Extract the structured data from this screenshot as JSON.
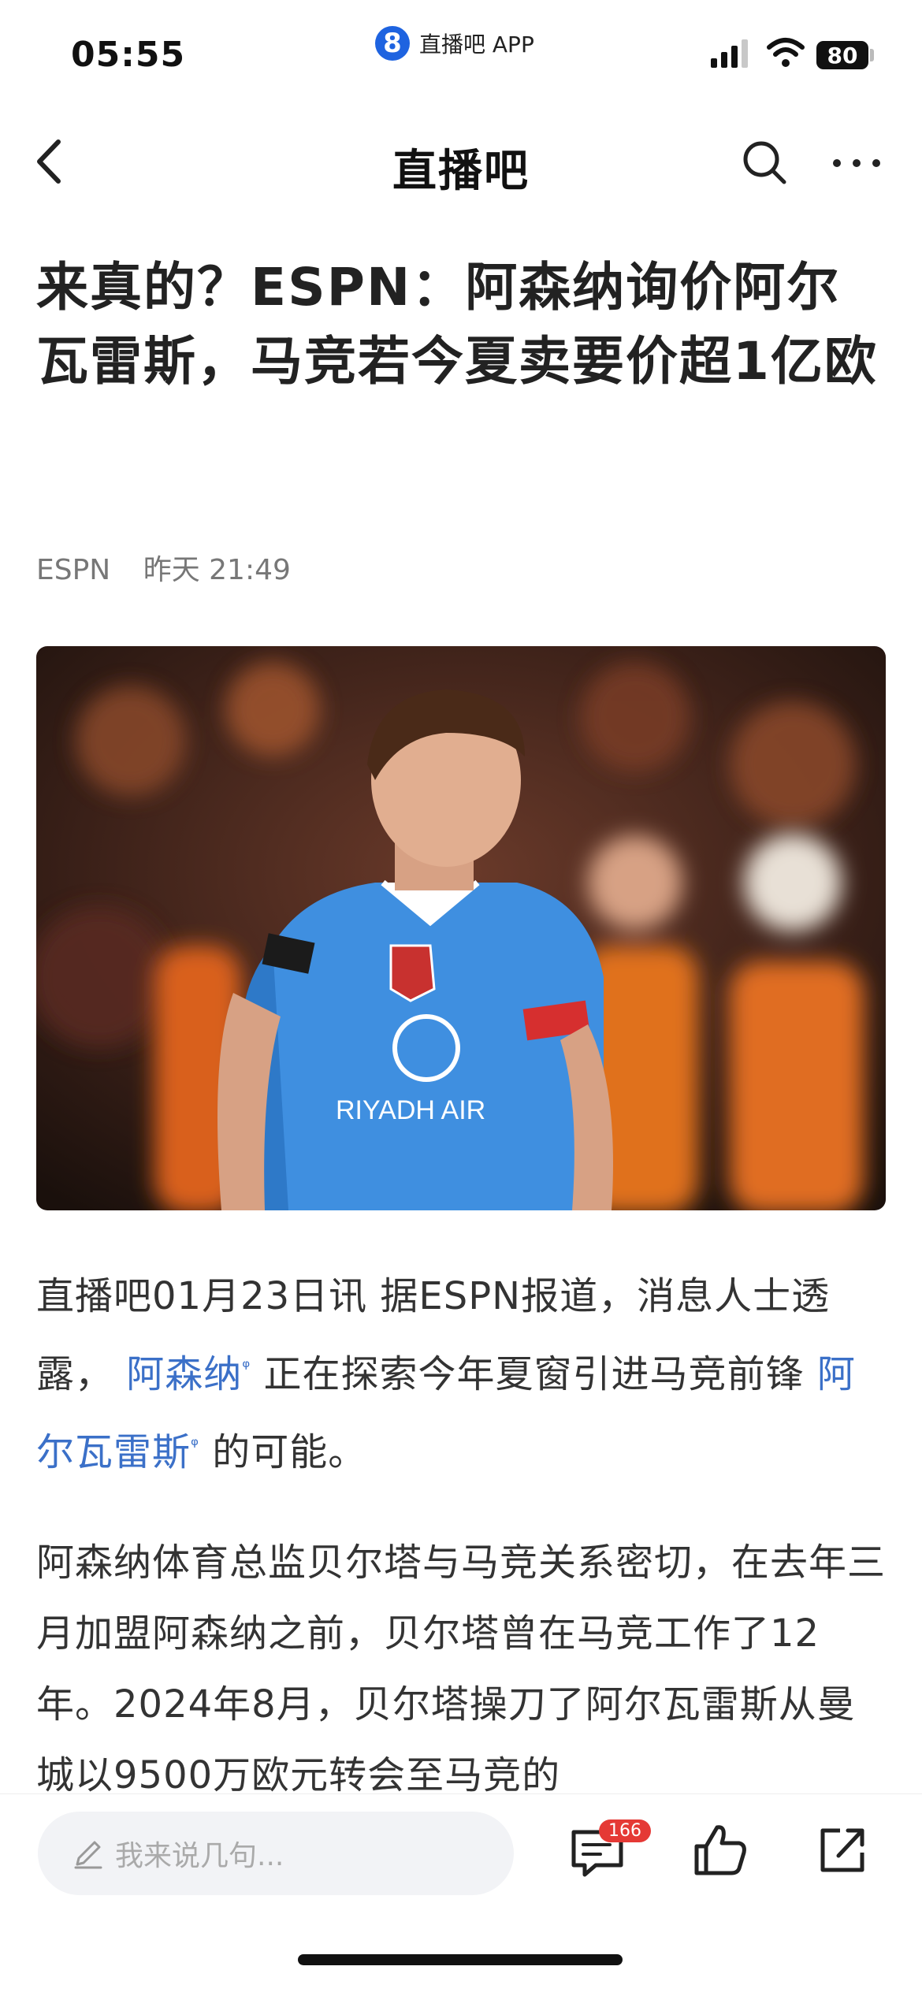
{
  "status_bar": {
    "time": "05:55",
    "app_logo": "8",
    "app_name": "直播吧 APP",
    "battery": "80"
  },
  "nav": {
    "title": "直播吧",
    "icons": [
      "back-arrow-icon",
      "search-icon",
      "more-icon"
    ]
  },
  "article": {
    "title": "来真的？ESPN：阿森纳询价阿尔瓦雷斯，马竞若今夏卖要价超1亿欧",
    "source": "ESPN",
    "time": "昨天 21:49",
    "hero_image": {
      "jersey_text": "RIYADH AIR"
    },
    "paragraph1": {
      "part1": "直播吧01月23日讯 据ESPN报道，消息人士透露，",
      "link1": "阿森纳",
      "part2": " 正在探索今年夏窗引进马竞前锋",
      "link2": "阿尔瓦雷斯",
      "part3": " 的可能。"
    },
    "paragraph2": "阿森纳体育总监贝尔塔与马竞关系密切，在去年三月加盟阿森纳之前，贝尔塔曾在马竞工作了12年。2024年8月，贝尔塔操刀了阿尔瓦雷斯从曼城以9500万欧元转会至马竞的"
  },
  "bottom_bar": {
    "comment_placeholder": "我来说几句...",
    "comment_count": "166"
  },
  "colors": {
    "link": "#3b70c8",
    "badge": "#e53935",
    "brand": "#1e63e0"
  }
}
